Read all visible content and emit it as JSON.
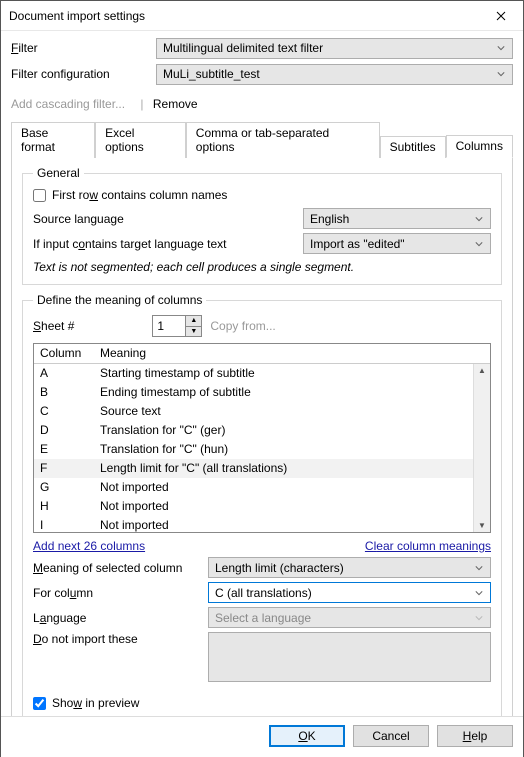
{
  "window": {
    "title": "Document import settings",
    "close": "✕"
  },
  "filter": {
    "label": "Filter",
    "value": "Multilingual delimited text filter",
    "config_label": "Filter configuration",
    "config_value": "MuLi_subtitle_test",
    "add_cascading": "Add cascading filter...",
    "sep": "|",
    "remove": "Remove"
  },
  "tabs": {
    "items": [
      {
        "label": "Base format"
      },
      {
        "label": "Excel options"
      },
      {
        "label": "Comma or tab-separated options"
      },
      {
        "label": "Subtitles"
      },
      {
        "label": "Columns"
      }
    ],
    "active": 4
  },
  "general": {
    "legend": "General",
    "first_row": "First row contains column names",
    "source_lang_label": "Source language",
    "source_lang_value": "English",
    "input_contains_label": "If input contains target language text",
    "input_contains_value": "Import as \"edited\"",
    "note": "Text is not segmented; each cell produces a single segment."
  },
  "define": {
    "legend": "Define the meaning of columns",
    "sheet_label": "Sheet #",
    "sheet_value": "1",
    "copy_from": "Copy from...",
    "headers": {
      "column": "Column",
      "meaning": "Meaning"
    },
    "rows": [
      {
        "c": "A",
        "m": "Starting timestamp of subtitle"
      },
      {
        "c": "B",
        "m": "Ending timestamp of subtitle"
      },
      {
        "c": "C",
        "m": "Source text"
      },
      {
        "c": "D",
        "m": "Translation for \"C\" (ger)"
      },
      {
        "c": "E",
        "m": "Translation for \"C\" (hun)"
      },
      {
        "c": "F",
        "m": "Length limit for \"C\" (all translations)"
      },
      {
        "c": "G",
        "m": "Not imported"
      },
      {
        "c": "H",
        "m": "Not imported"
      },
      {
        "c": "I",
        "m": "Not imported"
      }
    ],
    "selected_row": 5,
    "add_next": "Add next 26 columns",
    "clear": "Clear column meanings",
    "meaning_sel_label": "Meaning of selected column",
    "meaning_sel_value": "Length limit (characters)",
    "for_col_label": "For column",
    "for_col_value": "C (all translations)",
    "language_label": "Language",
    "language_value": "Select a language",
    "do_not_import_label": "Do not import these",
    "show_preview": "Show in preview"
  },
  "buttons": {
    "ok": "OK",
    "cancel": "Cancel",
    "help": "Help"
  }
}
